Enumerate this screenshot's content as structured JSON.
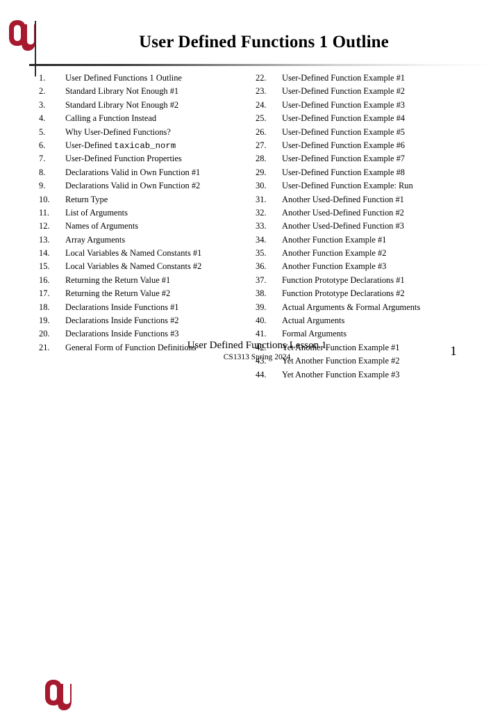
{
  "slide": {
    "title": "User Defined Functions 1 Outline",
    "page_number": "1",
    "brand_color": "#a6192e",
    "logo_name": "ou-logo"
  },
  "footer": {
    "line1": "User Defined Functions Lesson 1",
    "line2": "CS1313 Spring 2024"
  },
  "outline": {
    "left_column": [
      {
        "number": "1.",
        "label": "User Defined Functions 1 Outline"
      },
      {
        "number": "2.",
        "label": "Standard Library Not Enough #1"
      },
      {
        "number": "3.",
        "label": "Standard Library Not Enough #2"
      },
      {
        "number": "4.",
        "label": "Calling a Function Instead"
      },
      {
        "number": "5.",
        "label": "Why User-Defined Functions?"
      },
      {
        "number": "6.",
        "label": "User-Defined ",
        "mono": "taxicab_norm"
      },
      {
        "number": "7.",
        "label": "User-Defined Function Properties"
      },
      {
        "number": "8.",
        "label": "Declarations Valid in Own Function #1"
      },
      {
        "number": "9.",
        "label": "Declarations Valid in Own Function #2"
      },
      {
        "number": "10.",
        "label": "Return Type"
      },
      {
        "number": "11.",
        "label": "List of Arguments"
      },
      {
        "number": "12.",
        "label": "Names of Arguments"
      },
      {
        "number": "13.",
        "label": "Array Arguments"
      },
      {
        "number": "14.",
        "label": "Local Variables & Named Constants #1"
      },
      {
        "number": "15.",
        "label": "Local Variables & Named Constants #2"
      },
      {
        "number": "16.",
        "label": "Returning the Return Value #1"
      },
      {
        "number": "17.",
        "label": "Returning the Return Value #2"
      },
      {
        "number": "18.",
        "label": "Declarations Inside Functions #1"
      },
      {
        "number": "19.",
        "label": "Declarations Inside Functions #2"
      },
      {
        "number": "20.",
        "label": "Declarations Inside Functions #3"
      },
      {
        "number": "21.",
        "label": "General Form of Function Definitions"
      }
    ],
    "right_column": [
      {
        "number": "22.",
        "label": "User-Defined Function Example #1"
      },
      {
        "number": "23.",
        "label": "User-Defined Function Example #2"
      },
      {
        "number": "24.",
        "label": "User-Defined Function Example #3"
      },
      {
        "number": "25.",
        "label": "User-Defined Function Example #4"
      },
      {
        "number": "26.",
        "label": "User-Defined Function Example #5"
      },
      {
        "number": "27.",
        "label": "User-Defined Function Example #6"
      },
      {
        "number": "28.",
        "label": "User-Defined Function Example #7"
      },
      {
        "number": "29.",
        "label": "User-Defined Function Example #8"
      },
      {
        "number": "30.",
        "label": "User-Defined Function Example: Run"
      },
      {
        "number": "31.",
        "label": "Another Used-Defined Function #1"
      },
      {
        "number": "32.",
        "label": "Another Used-Defined Function #2"
      },
      {
        "number": "33.",
        "label": "Another Used-Defined Function #3"
      },
      {
        "number": "34.",
        "label": "Another Function Example #1"
      },
      {
        "number": "35.",
        "label": "Another Function Example #2"
      },
      {
        "number": "36.",
        "label": "Another Function Example #3"
      },
      {
        "number": "37.",
        "label": "Function Prototype Declarations #1"
      },
      {
        "number": "38.",
        "label": "Function Prototype Declarations #2"
      },
      {
        "number": "39.",
        "label": "Actual Arguments & Formal Arguments"
      },
      {
        "number": "40.",
        "label": "Actual Arguments"
      },
      {
        "number": "41.",
        "label": "Formal Arguments"
      },
      {
        "number": "42.",
        "label": "Yet Another Function Example #1"
      },
      {
        "number": "43.",
        "label": "Yet Another Function Example #2"
      },
      {
        "number": "44.",
        "label": "Yet Another Function Example #3"
      }
    ]
  }
}
